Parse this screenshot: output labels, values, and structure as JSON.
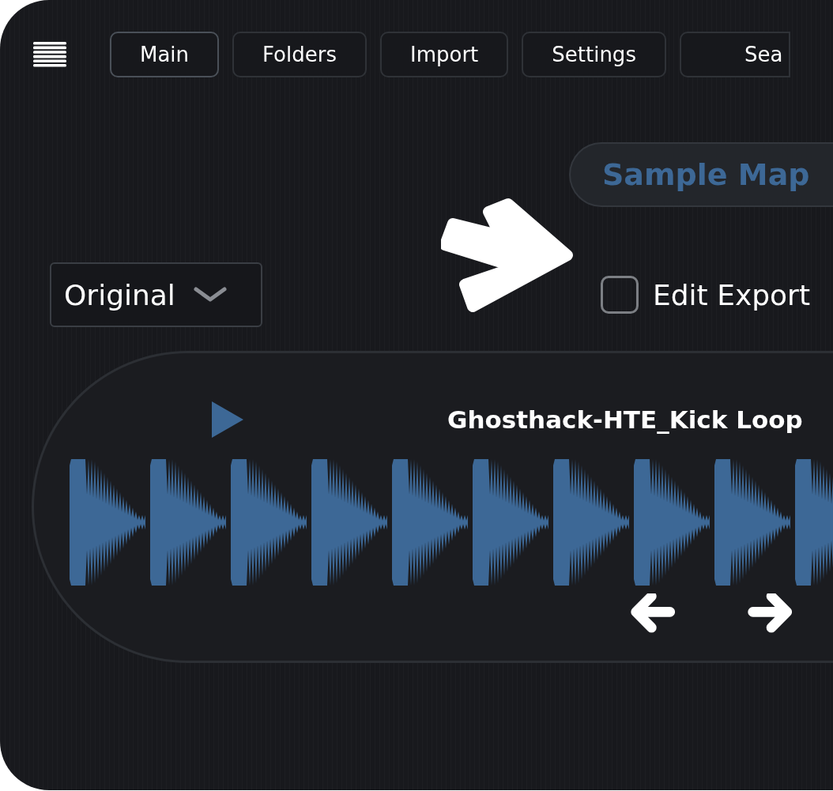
{
  "tabs": [
    {
      "label": "Main",
      "selected": true
    },
    {
      "label": "Folders",
      "selected": false
    },
    {
      "label": "Import",
      "selected": false
    },
    {
      "label": "Settings",
      "selected": false
    },
    {
      "label": "Sea",
      "selected": false
    }
  ],
  "sample_map_button": {
    "label": "Sample Map"
  },
  "dropdown": {
    "value": "Original"
  },
  "edit_export": {
    "label": "Edit Export",
    "checked": false
  },
  "player": {
    "title": "Ghosthack-HTE_Kick Loop"
  }
}
